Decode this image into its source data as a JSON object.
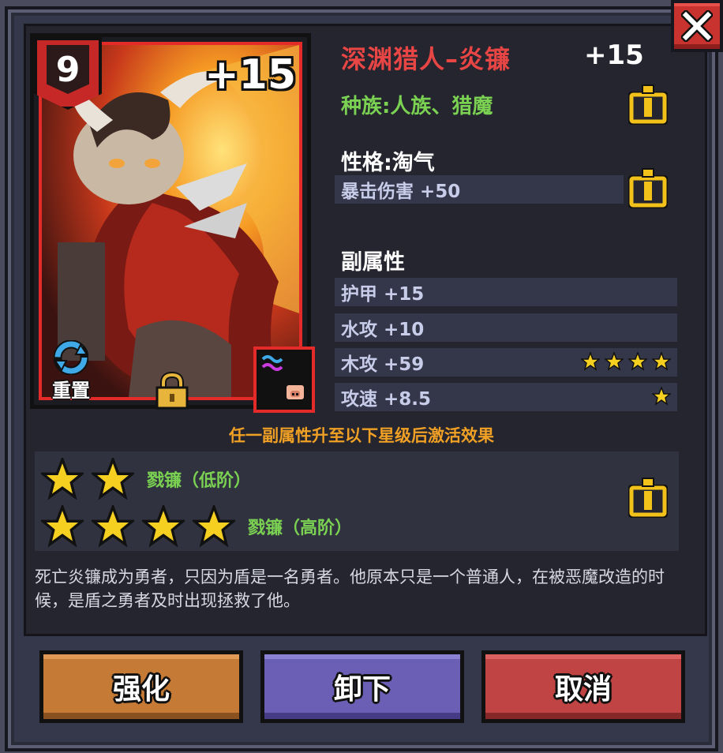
{
  "card": {
    "level": "9",
    "plus": "+15",
    "reset_label": "重置",
    "lock_icon": "lock-icon",
    "element_icon": "water-element-icon"
  },
  "hero": {
    "name": "深渊猎人–炎镰",
    "plus": "+15",
    "race": "种族:人族、猎魔"
  },
  "trait": {
    "title": "性格:淘气",
    "stat": "暴击伤害 +50"
  },
  "substats": {
    "title": "副属性",
    "items": [
      {
        "label": "护甲 +15",
        "stars": 0
      },
      {
        "label": "水攻 +10",
        "stars": 0
      },
      {
        "label": "木攻 +59",
        "stars": 4
      },
      {
        "label": "攻速 +8.5",
        "stars": 1
      }
    ]
  },
  "activation": {
    "hint": "任一副属性升至以下星级后激活效果",
    "effects": [
      {
        "stars": 2,
        "label": "戮镰（低阶）"
      },
      {
        "stars": 4,
        "label": "戮镰（高阶）"
      }
    ]
  },
  "description": "死亡炎镰成为勇者，只因为盾是一名勇者。他原本只是一个普通人，在被恶魔改造的时候，是盾之勇者及时出现拯救了他。",
  "buttons": {
    "enhance": "强化",
    "unequip": "卸下",
    "cancel": "取消"
  },
  "colors": {
    "name": "#e84545",
    "race": "#7ad152",
    "hint": "#f0a024",
    "star": "#f5d020",
    "card_border": "#e52a2a"
  }
}
